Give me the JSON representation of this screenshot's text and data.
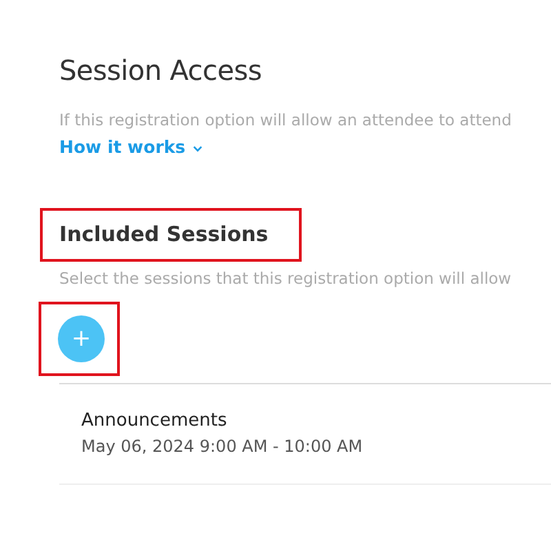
{
  "title": "Session Access",
  "description": "If this registration option will allow an attendee to attend",
  "help_link": {
    "label": "How it works",
    "expanded": false
  },
  "included_sessions": {
    "heading": "Included Sessions",
    "highlighted": true,
    "description": "Select the sessions that this registration option will allow",
    "add_button": {
      "label": "+",
      "highlighted": true
    },
    "sessions": [
      {
        "name": "Announcements",
        "time": "May 06, 2024 9:00 AM - 10:00 AM"
      }
    ]
  }
}
